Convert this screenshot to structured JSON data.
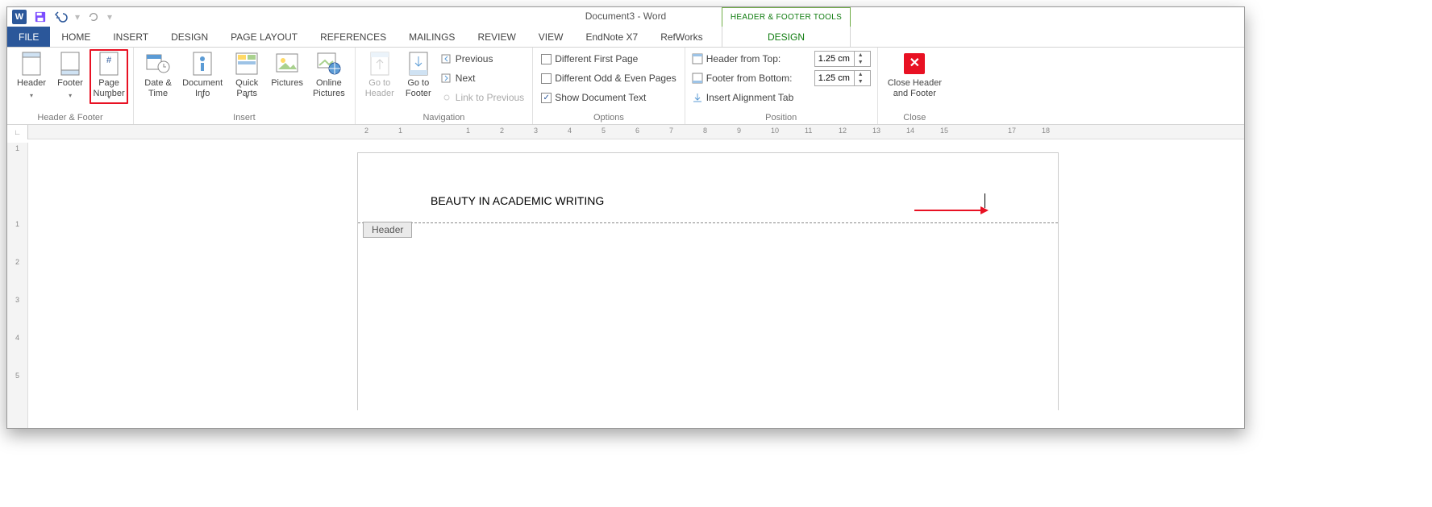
{
  "title": "Document3 - Word",
  "context_tools_title": "HEADER & FOOTER TOOLS",
  "tabs": {
    "file": "FILE",
    "home": "HOME",
    "insert": "INSERT",
    "design": "DESIGN",
    "page_layout": "PAGE LAYOUT",
    "references": "REFERENCES",
    "mailings": "MAILINGS",
    "review": "REVIEW",
    "view": "VIEW",
    "endnote": "EndNote X7",
    "refworks": "RefWorks",
    "design_ctx": "DESIGN"
  },
  "groups": {
    "hf": {
      "label": "Header & Footer",
      "header": "Header",
      "footer": "Footer",
      "page_number_l1": "Page",
      "page_number_l2": "Number"
    },
    "insert": {
      "label": "Insert",
      "date_time_l1": "Date &",
      "date_time_l2": "Time",
      "doc_info_l1": "Document",
      "doc_info_l2": "Info",
      "quick_parts_l1": "Quick",
      "quick_parts_l2": "Parts",
      "pictures": "Pictures",
      "online_pics_l1": "Online",
      "online_pics_l2": "Pictures"
    },
    "navigation": {
      "label": "Navigation",
      "goto_header_l1": "Go to",
      "goto_header_l2": "Header",
      "goto_footer_l1": "Go to",
      "goto_footer_l2": "Footer",
      "previous": "Previous",
      "next": "Next",
      "link_prev": "Link to Previous"
    },
    "options": {
      "label": "Options",
      "diff_first": "Different First Page",
      "diff_odd_even": "Different Odd & Even Pages",
      "show_doc_text": "Show Document Text"
    },
    "position": {
      "label": "Position",
      "header_top": "Header from Top:",
      "footer_bottom": "Footer from Bottom:",
      "insert_align_tab": "Insert Alignment Tab",
      "header_top_val": "1.25 cm",
      "footer_bottom_val": "1.25 cm"
    },
    "close": {
      "label": "Close",
      "btn_l1": "Close Header",
      "btn_l2": "and Footer"
    }
  },
  "ruler": {
    "h": [
      "2",
      "1",
      "",
      "1",
      "2",
      "3",
      "4",
      "5",
      "6",
      "7",
      "8",
      "9",
      "10",
      "11",
      "12",
      "13",
      "14",
      "15",
      "",
      "17",
      "18"
    ],
    "v": [
      "1",
      "",
      "1",
      "2",
      "3",
      "4",
      "5"
    ]
  },
  "document": {
    "header_text": "BEAUTY IN ACADEMIC WRITING",
    "header_tag": "Header"
  }
}
